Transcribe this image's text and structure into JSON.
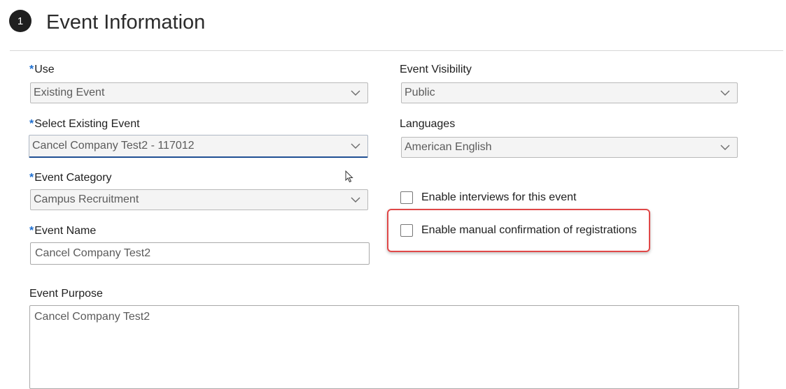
{
  "section": {
    "step_number": "1",
    "title": "Event Information"
  },
  "fields": {
    "use": {
      "required_mark": "*",
      "label": "Use",
      "value": "Existing Event"
    },
    "select_existing_event": {
      "required_mark": "*",
      "label": "Select Existing Event",
      "value": "Cancel Company Test2 - 117012"
    },
    "event_category": {
      "required_mark": "*",
      "label": "Event Category",
      "value": "Campus Recruitment"
    },
    "event_name": {
      "required_mark": "*",
      "label": "Event Name",
      "value": "Cancel Company Test2"
    },
    "event_visibility": {
      "label": "Event Visibility",
      "value": "Public"
    },
    "languages": {
      "label": "Languages",
      "value": "American English"
    },
    "event_purpose": {
      "label": "Event Purpose",
      "value": "Cancel Company Test2"
    }
  },
  "checkboxes": {
    "enable_interviews": {
      "label": "Enable interviews for this event",
      "checked": false
    },
    "enable_manual_confirmation": {
      "label": "Enable manual confirmation of registrations",
      "checked": false
    }
  },
  "colors": {
    "required": "#1e6fd0",
    "focus_underline": "#1f4f93",
    "highlight": "#e04848"
  }
}
